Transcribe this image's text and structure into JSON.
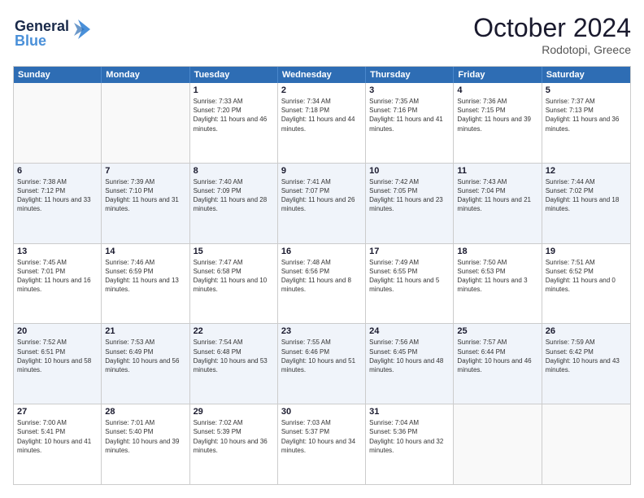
{
  "header": {
    "logo_line1": "General",
    "logo_line2": "Blue",
    "month_title": "October 2024",
    "location": "Rodotopi, Greece"
  },
  "days_of_week": [
    "Sunday",
    "Monday",
    "Tuesday",
    "Wednesday",
    "Thursday",
    "Friday",
    "Saturday"
  ],
  "weeks": [
    [
      {
        "day": "",
        "sunrise": "",
        "sunset": "",
        "daylight": "",
        "empty": true
      },
      {
        "day": "",
        "sunrise": "",
        "sunset": "",
        "daylight": "",
        "empty": true
      },
      {
        "day": "1",
        "sunrise": "Sunrise: 7:33 AM",
        "sunset": "Sunset: 7:20 PM",
        "daylight": "Daylight: 11 hours and 46 minutes.",
        "empty": false
      },
      {
        "day": "2",
        "sunrise": "Sunrise: 7:34 AM",
        "sunset": "Sunset: 7:18 PM",
        "daylight": "Daylight: 11 hours and 44 minutes.",
        "empty": false
      },
      {
        "day": "3",
        "sunrise": "Sunrise: 7:35 AM",
        "sunset": "Sunset: 7:16 PM",
        "daylight": "Daylight: 11 hours and 41 minutes.",
        "empty": false
      },
      {
        "day": "4",
        "sunrise": "Sunrise: 7:36 AM",
        "sunset": "Sunset: 7:15 PM",
        "daylight": "Daylight: 11 hours and 39 minutes.",
        "empty": false
      },
      {
        "day": "5",
        "sunrise": "Sunrise: 7:37 AM",
        "sunset": "Sunset: 7:13 PM",
        "daylight": "Daylight: 11 hours and 36 minutes.",
        "empty": false
      }
    ],
    [
      {
        "day": "6",
        "sunrise": "Sunrise: 7:38 AM",
        "sunset": "Sunset: 7:12 PM",
        "daylight": "Daylight: 11 hours and 33 minutes.",
        "empty": false
      },
      {
        "day": "7",
        "sunrise": "Sunrise: 7:39 AM",
        "sunset": "Sunset: 7:10 PM",
        "daylight": "Daylight: 11 hours and 31 minutes.",
        "empty": false
      },
      {
        "day": "8",
        "sunrise": "Sunrise: 7:40 AM",
        "sunset": "Sunset: 7:09 PM",
        "daylight": "Daylight: 11 hours and 28 minutes.",
        "empty": false
      },
      {
        "day": "9",
        "sunrise": "Sunrise: 7:41 AM",
        "sunset": "Sunset: 7:07 PM",
        "daylight": "Daylight: 11 hours and 26 minutes.",
        "empty": false
      },
      {
        "day": "10",
        "sunrise": "Sunrise: 7:42 AM",
        "sunset": "Sunset: 7:05 PM",
        "daylight": "Daylight: 11 hours and 23 minutes.",
        "empty": false
      },
      {
        "day": "11",
        "sunrise": "Sunrise: 7:43 AM",
        "sunset": "Sunset: 7:04 PM",
        "daylight": "Daylight: 11 hours and 21 minutes.",
        "empty": false
      },
      {
        "day": "12",
        "sunrise": "Sunrise: 7:44 AM",
        "sunset": "Sunset: 7:02 PM",
        "daylight": "Daylight: 11 hours and 18 minutes.",
        "empty": false
      }
    ],
    [
      {
        "day": "13",
        "sunrise": "Sunrise: 7:45 AM",
        "sunset": "Sunset: 7:01 PM",
        "daylight": "Daylight: 11 hours and 16 minutes.",
        "empty": false
      },
      {
        "day": "14",
        "sunrise": "Sunrise: 7:46 AM",
        "sunset": "Sunset: 6:59 PM",
        "daylight": "Daylight: 11 hours and 13 minutes.",
        "empty": false
      },
      {
        "day": "15",
        "sunrise": "Sunrise: 7:47 AM",
        "sunset": "Sunset: 6:58 PM",
        "daylight": "Daylight: 11 hours and 10 minutes.",
        "empty": false
      },
      {
        "day": "16",
        "sunrise": "Sunrise: 7:48 AM",
        "sunset": "Sunset: 6:56 PM",
        "daylight": "Daylight: 11 hours and 8 minutes.",
        "empty": false
      },
      {
        "day": "17",
        "sunrise": "Sunrise: 7:49 AM",
        "sunset": "Sunset: 6:55 PM",
        "daylight": "Daylight: 11 hours and 5 minutes.",
        "empty": false
      },
      {
        "day": "18",
        "sunrise": "Sunrise: 7:50 AM",
        "sunset": "Sunset: 6:53 PM",
        "daylight": "Daylight: 11 hours and 3 minutes.",
        "empty": false
      },
      {
        "day": "19",
        "sunrise": "Sunrise: 7:51 AM",
        "sunset": "Sunset: 6:52 PM",
        "daylight": "Daylight: 11 hours and 0 minutes.",
        "empty": false
      }
    ],
    [
      {
        "day": "20",
        "sunrise": "Sunrise: 7:52 AM",
        "sunset": "Sunset: 6:51 PM",
        "daylight": "Daylight: 10 hours and 58 minutes.",
        "empty": false
      },
      {
        "day": "21",
        "sunrise": "Sunrise: 7:53 AM",
        "sunset": "Sunset: 6:49 PM",
        "daylight": "Daylight: 10 hours and 56 minutes.",
        "empty": false
      },
      {
        "day": "22",
        "sunrise": "Sunrise: 7:54 AM",
        "sunset": "Sunset: 6:48 PM",
        "daylight": "Daylight: 10 hours and 53 minutes.",
        "empty": false
      },
      {
        "day": "23",
        "sunrise": "Sunrise: 7:55 AM",
        "sunset": "Sunset: 6:46 PM",
        "daylight": "Daylight: 10 hours and 51 minutes.",
        "empty": false
      },
      {
        "day": "24",
        "sunrise": "Sunrise: 7:56 AM",
        "sunset": "Sunset: 6:45 PM",
        "daylight": "Daylight: 10 hours and 48 minutes.",
        "empty": false
      },
      {
        "day": "25",
        "sunrise": "Sunrise: 7:57 AM",
        "sunset": "Sunset: 6:44 PM",
        "daylight": "Daylight: 10 hours and 46 minutes.",
        "empty": false
      },
      {
        "day": "26",
        "sunrise": "Sunrise: 7:59 AM",
        "sunset": "Sunset: 6:42 PM",
        "daylight": "Daylight: 10 hours and 43 minutes.",
        "empty": false
      }
    ],
    [
      {
        "day": "27",
        "sunrise": "Sunrise: 7:00 AM",
        "sunset": "Sunset: 5:41 PM",
        "daylight": "Daylight: 10 hours and 41 minutes.",
        "empty": false
      },
      {
        "day": "28",
        "sunrise": "Sunrise: 7:01 AM",
        "sunset": "Sunset: 5:40 PM",
        "daylight": "Daylight: 10 hours and 39 minutes.",
        "empty": false
      },
      {
        "day": "29",
        "sunrise": "Sunrise: 7:02 AM",
        "sunset": "Sunset: 5:39 PM",
        "daylight": "Daylight: 10 hours and 36 minutes.",
        "empty": false
      },
      {
        "day": "30",
        "sunrise": "Sunrise: 7:03 AM",
        "sunset": "Sunset: 5:37 PM",
        "daylight": "Daylight: 10 hours and 34 minutes.",
        "empty": false
      },
      {
        "day": "31",
        "sunrise": "Sunrise: 7:04 AM",
        "sunset": "Sunset: 5:36 PM",
        "daylight": "Daylight: 10 hours and 32 minutes.",
        "empty": false
      },
      {
        "day": "",
        "sunrise": "",
        "sunset": "",
        "daylight": "",
        "empty": true
      },
      {
        "day": "",
        "sunrise": "",
        "sunset": "",
        "daylight": "",
        "empty": true
      }
    ]
  ]
}
